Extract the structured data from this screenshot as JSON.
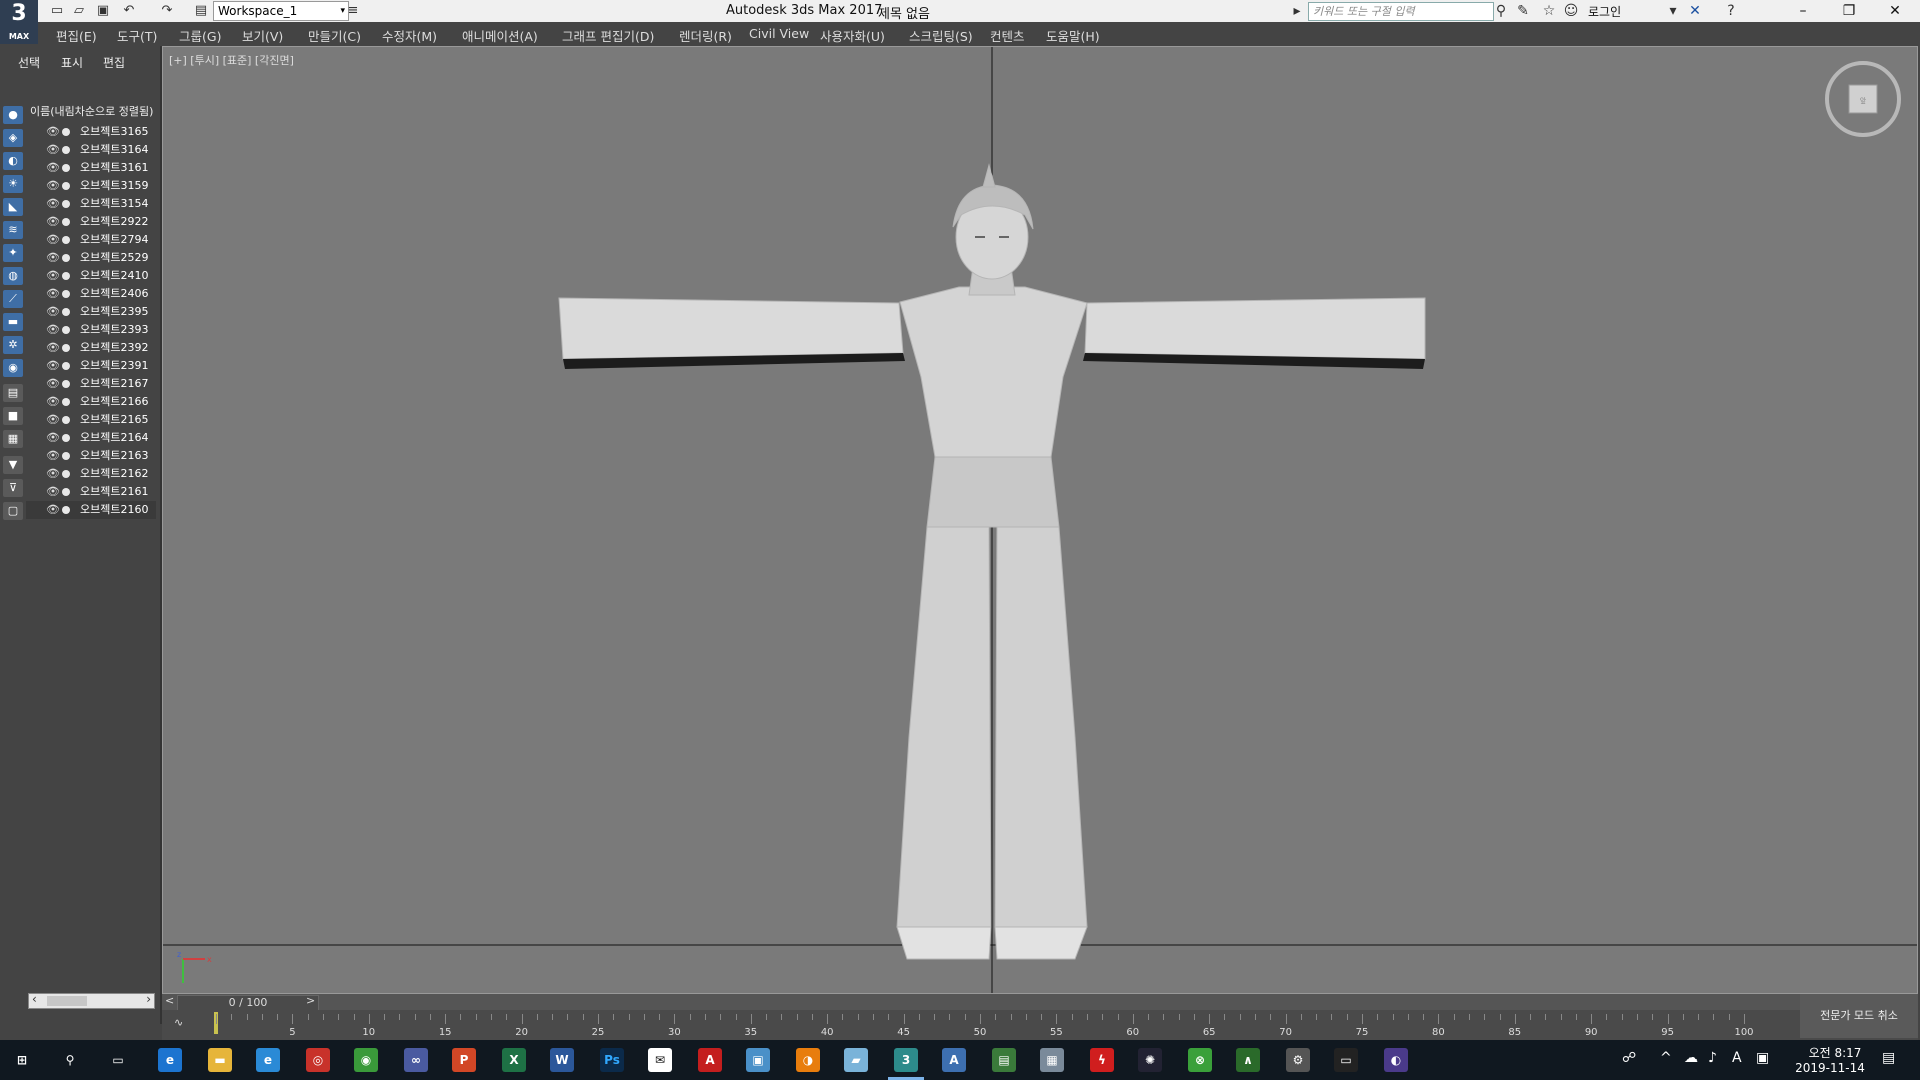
{
  "app": {
    "logo_text": "3",
    "logo_sub": "MAX",
    "workspace": "Workspace_1",
    "title": "Autodesk 3ds Max 2017",
    "document": "제목 없음",
    "search_placeholder": "키워드 또는 구절 입력",
    "login": "로그인"
  },
  "menu": [
    "편집(E)",
    "도구(T)",
    "그룹(G)",
    "보기(V)",
    "만들기(C)",
    "수정자(M)",
    "애니메이션(A)",
    "그래프 편집기(D)",
    "렌더링(R)",
    "Civil View",
    "사용자화(U)",
    "스크립팅(S)",
    "컨텐츠",
    "도움말(H)"
  ],
  "explorer": {
    "tabs": [
      "선택",
      "표시",
      "편집"
    ],
    "header": "이름(내림차순으로 정렬됨)",
    "objects": [
      "오브젝트3165",
      "오브젝트3164",
      "오브젝트3161",
      "오브젝트3159",
      "오브젝트3154",
      "오브젝트2922",
      "오브젝트2794",
      "오브젝트2529",
      "오브젝트2410",
      "오브젝트2406",
      "오브젝트2395",
      "오브젝트2393",
      "오브젝트2392",
      "오브젝트2391",
      "오브젝트2167",
      "오브젝트2166",
      "오브젝트2165",
      "오브젝트2164",
      "오브젝트2163",
      "오브젝트2162",
      "오브젝트2161",
      "오브젝트2160"
    ]
  },
  "viewport": {
    "label": "[+] [투시] [표준] [각진면]"
  },
  "timeline": {
    "position": "0 / 100",
    "ticks": [
      "5",
      "10",
      "15",
      "20",
      "25",
      "30",
      "35",
      "40",
      "45",
      "50",
      "55",
      "60",
      "65",
      "70",
      "75",
      "80",
      "85",
      "90",
      "95",
      "100"
    ],
    "expert_button": "전문가 모드 취소"
  },
  "taskbar": {
    "time": "오전 8:17",
    "date": "2019-11-14"
  }
}
